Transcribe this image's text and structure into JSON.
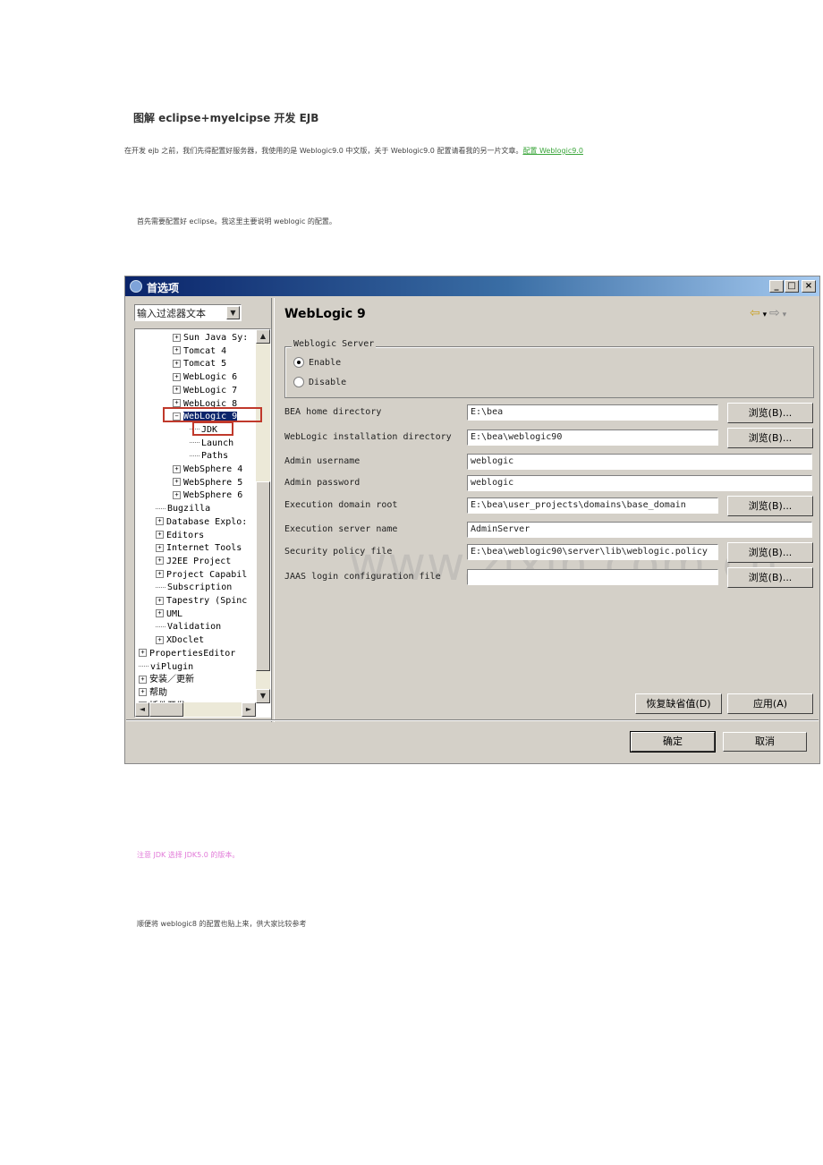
{
  "doc": {
    "title": "图解 eclipse+myelcipse 开发 EJB",
    "intro": "在开发 ejb 之前，我们先得配置好服务器，我使用的是 Weblogic9.0 中文版，关于 Weblogic9.0 配置请看我的另一片文章。",
    "intro_link": "配置 Weblogic9.0",
    "para1": "首先需要配置好 eclipse。我这里主要说明 weblogic 的配置。",
    "note": "注意 JDK 选择 JDK5.0 的版本。",
    "para2": "顺便将 weblogic8 的配置也贴上来，供大家比较参考"
  },
  "dialog": {
    "title": "首选项",
    "filter_text": "输入过滤器文本",
    "page_title": "WebLogic 9",
    "watermark": "www.zixin.com.cn",
    "tree": [
      {
        "label": "Sun Java Sy:",
        "indent": 2,
        "expander": "+"
      },
      {
        "label": "Tomcat 4",
        "indent": 2,
        "expander": "+"
      },
      {
        "label": "Tomcat 5",
        "indent": 2,
        "expander": "+"
      },
      {
        "label": "WebLogic 6",
        "indent": 2,
        "expander": "+"
      },
      {
        "label": "WebLogic 7",
        "indent": 2,
        "expander": "+"
      },
      {
        "label": "WebLogic 8",
        "indent": 2,
        "expander": "+"
      },
      {
        "label": "WebLogic 9",
        "indent": 2,
        "expander": "-",
        "selected": true
      },
      {
        "label": "JDK",
        "indent": 3,
        "expander": ""
      },
      {
        "label": "Launch",
        "indent": 3,
        "expander": ""
      },
      {
        "label": "Paths",
        "indent": 3,
        "expander": ""
      },
      {
        "label": "WebSphere 4",
        "indent": 2,
        "expander": "+"
      },
      {
        "label": "WebSphere 5",
        "indent": 2,
        "expander": "+"
      },
      {
        "label": "WebSphere 6",
        "indent": 2,
        "expander": "+"
      },
      {
        "label": "Bugzilla",
        "indent": 1,
        "expander": ""
      },
      {
        "label": "Database Explo:",
        "indent": 1,
        "expander": "+"
      },
      {
        "label": "Editors",
        "indent": 1,
        "expander": "+"
      },
      {
        "label": "Internet Tools",
        "indent": 1,
        "expander": "+"
      },
      {
        "label": "J2EE Project",
        "indent": 1,
        "expander": "+"
      },
      {
        "label": "Project Capabil",
        "indent": 1,
        "expander": "+"
      },
      {
        "label": "Subscription",
        "indent": 1,
        "expander": ""
      },
      {
        "label": "Tapestry (Spinc",
        "indent": 1,
        "expander": "+"
      },
      {
        "label": "UML",
        "indent": 1,
        "expander": "+"
      },
      {
        "label": "Validation",
        "indent": 1,
        "expander": ""
      },
      {
        "label": "XDoclet",
        "indent": 1,
        "expander": "+"
      },
      {
        "label": "PropertiesEditor",
        "indent": 0,
        "expander": "+"
      },
      {
        "label": "viPlugin",
        "indent": 0,
        "expander": ""
      },
      {
        "label": "安装／更新",
        "indent": 0,
        "expander": "+"
      },
      {
        "label": "帮助",
        "indent": 0,
        "expander": "+"
      },
      {
        "label": "插件开发",
        "indent": 0,
        "expander": "+"
      }
    ],
    "group_title": "Weblogic Server",
    "radio_enable": "Enable",
    "radio_disable": "Disable",
    "fields": [
      {
        "label": "BEA home directory",
        "value": "E:\\bea",
        "browse": true
      },
      {
        "label": "WebLogic installation directory",
        "value": "E:\\bea\\weblogic90",
        "browse": true
      },
      {
        "label": "Admin username",
        "value": "weblogic",
        "browse": false
      },
      {
        "label": "Admin password",
        "value": "weblogic",
        "browse": false
      },
      {
        "label": "Execution domain root",
        "value": "E:\\bea\\user_projects\\domains\\base_domain",
        "browse": true
      },
      {
        "label": "Execution server name",
        "value": "AdminServer",
        "browse": false
      },
      {
        "label": "Security policy file",
        "value": "E:\\bea\\weblogic90\\server\\lib\\weblogic.policy",
        "browse": true
      },
      {
        "label": "JAAS login configuration file",
        "value": "",
        "browse": true
      }
    ],
    "browse_label": "浏览(B)...",
    "restore_defaults": "恢复缺省值(D)",
    "apply": "应用(A)",
    "ok": "确定",
    "cancel": "取消"
  }
}
